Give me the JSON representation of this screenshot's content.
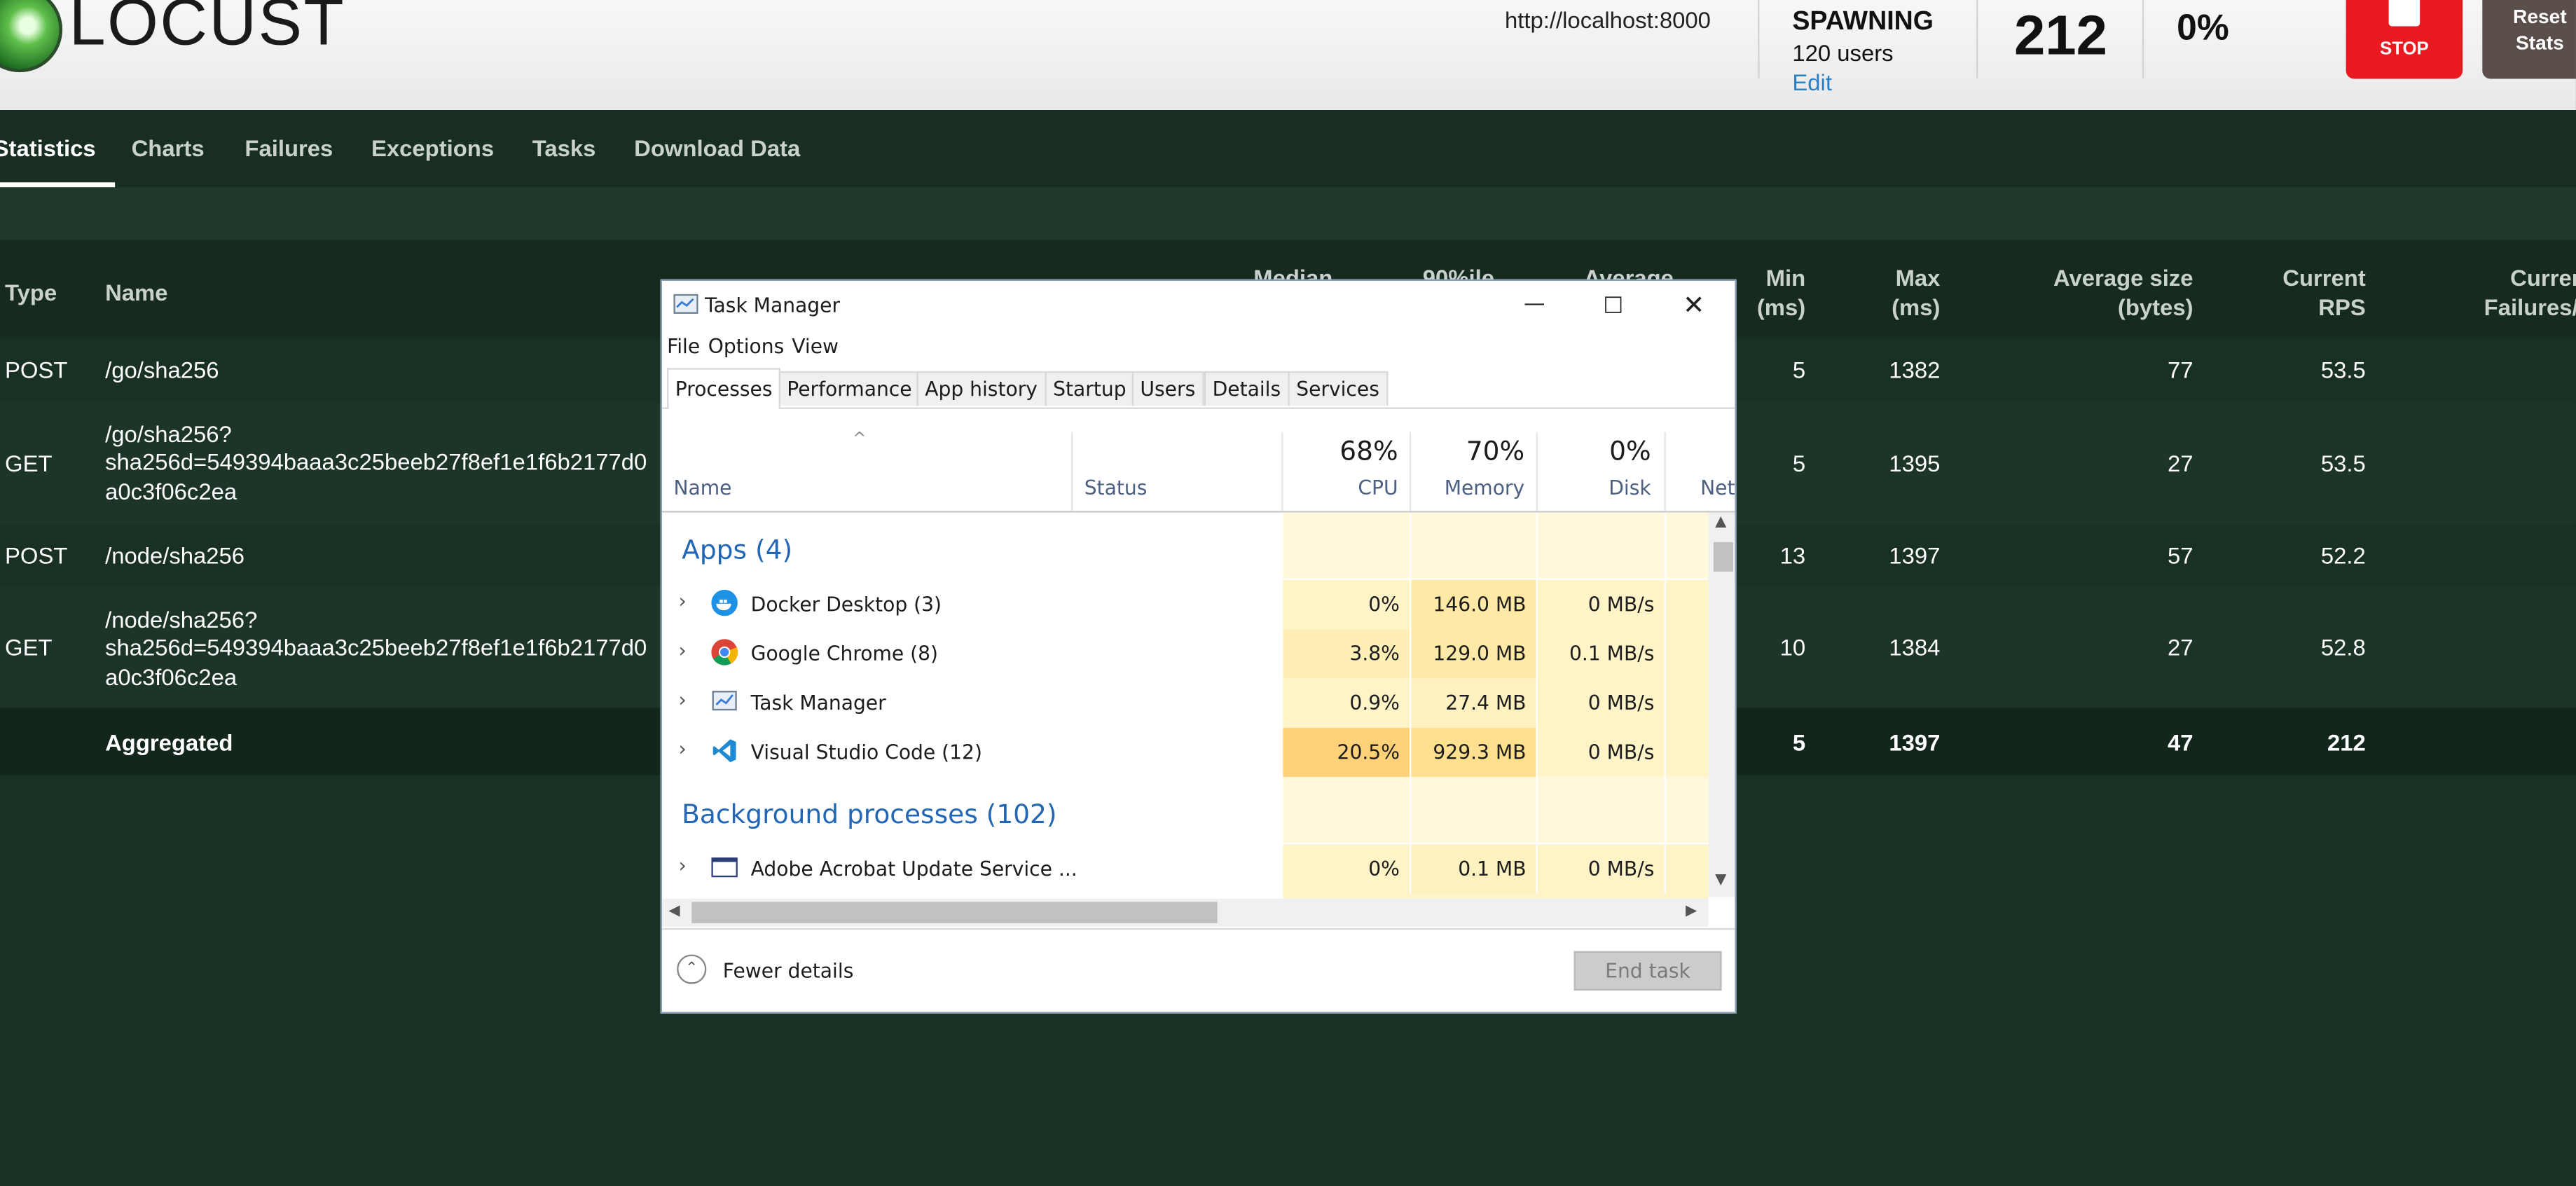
{
  "header": {
    "logo_text": "LOCUST",
    "host": "http://localhost:8000",
    "status_label": "SPAWNING",
    "users": "120 users",
    "edit": "Edit",
    "rps": "212",
    "failures": "0%",
    "stop": "STOP",
    "reset_line1": "Reset",
    "reset_line2": "Stats"
  },
  "colors": {
    "stop": "#e8191f",
    "reset": "#5b4f4c",
    "link": "#2a7fc9",
    "page_bg": "#193124",
    "group_header": "#2366b3"
  },
  "nav": [
    "Statistics",
    "Charts",
    "Failures",
    "Exceptions",
    "Tasks",
    "Download Data"
  ],
  "table": {
    "headers": {
      "type": "Type",
      "name": "Name",
      "median": "Median",
      "p90": "90%ile",
      "average": "Average",
      "min1": "Min",
      "min2": "(ms)",
      "max1": "Max",
      "max2": "(ms)",
      "avgsize1": "Average size",
      "avgsize2": "(bytes)",
      "rps1": "Current",
      "rps2": "RPS",
      "fail1": "Current",
      "fail2": "Failures/s"
    },
    "rows": [
      {
        "type": "POST",
        "name1": "/go/sha256",
        "name2": "",
        "name3": "",
        "min": "5",
        "max": "1382",
        "avg_size": "77",
        "rps": "53.5"
      },
      {
        "type": "GET",
        "name1": "/go/sha256?",
        "name2": "sha256d=549394baaa3c25beeb27f8ef1e1f6b2177d0",
        "name3": "a0c3f06c2ea",
        "min": "5",
        "max": "1395",
        "avg_size": "27",
        "rps": "53.5"
      },
      {
        "type": "POST",
        "name1": "/node/sha256",
        "name2": "",
        "name3": "",
        "min": "13",
        "max": "1397",
        "avg_size": "57",
        "rps": "52.2"
      },
      {
        "type": "GET",
        "name1": "/node/sha256?",
        "name2": "sha256d=549394baaa3c25beeb27f8ef1e1f6b2177d0",
        "name3": "a0c3f06c2ea",
        "min": "10",
        "max": "1384",
        "avg_size": "27",
        "rps": "52.8"
      }
    ],
    "aggregated": {
      "name": "Aggregated",
      "min": "5",
      "max": "1397",
      "avg_size": "47",
      "rps": "212"
    }
  },
  "task_manager": {
    "title": "Task Manager",
    "menu": [
      "File",
      "Options",
      "View"
    ],
    "tabs": [
      "Processes",
      "Performance",
      "App history",
      "Startup",
      "Users",
      "Details",
      "Services"
    ],
    "columns": {
      "name": "Name",
      "status": "Status",
      "cpu_pct": "68%",
      "cpu": "CPU",
      "mem_pct": "70%",
      "mem": "Memory",
      "disk_pct": "0%",
      "disk": "Disk",
      "net": "Network"
    },
    "groups": {
      "apps": "Apps (4)",
      "background": "Background processes (102)"
    },
    "apps": [
      {
        "name": "Docker Desktop (3)",
        "cpu": "0%",
        "mem": "146.0 MB",
        "disk": "0 MB/s",
        "icon": "docker-icon"
      },
      {
        "name": "Google Chrome (8)",
        "cpu": "3.8%",
        "mem": "129.0 MB",
        "disk": "0.1 MB/s",
        "icon": "chrome-icon"
      },
      {
        "name": "Task Manager",
        "cpu": "0.9%",
        "mem": "27.4 MB",
        "disk": "0 MB/s",
        "icon": "task-manager-icon"
      },
      {
        "name": "Visual Studio Code (12)",
        "cpu": "20.5%",
        "mem": "929.3 MB",
        "disk": "0 MB/s",
        "icon": "vscode-icon"
      }
    ],
    "background": [
      {
        "name": "Adobe Acrobat Update Service ...",
        "cpu": "0%",
        "mem": "0.1 MB",
        "disk": "0 MB/s",
        "icon": "window-icon"
      }
    ],
    "fewer_details": "Fewer details",
    "end_task": "End task"
  }
}
